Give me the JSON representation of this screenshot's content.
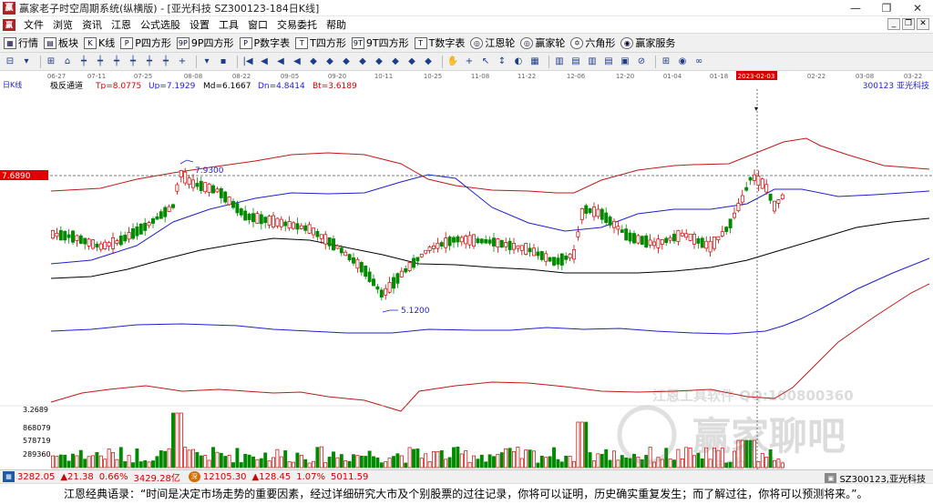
{
  "window": {
    "title": "赢家老子时空周期系统(纵横版) - [亚光科技  SZ300123-184日K线]",
    "controls": [
      "—",
      "❐",
      "✕"
    ]
  },
  "menu": {
    "items": [
      "文件",
      "浏览",
      "资讯",
      "江恩",
      "公式选股",
      "设置",
      "工具",
      "窗口",
      "交易委托",
      "帮助"
    ],
    "mdi": [
      "_",
      "❐",
      "✕"
    ]
  },
  "toolbar1": {
    "items": [
      {
        "icon": "grid-icon",
        "glyph": "▦",
        "label": "行情"
      },
      {
        "icon": "blocks-icon",
        "glyph": "▤",
        "label": "板块"
      },
      {
        "icon": "kline-icon",
        "glyph": "K",
        "label": "K线"
      },
      {
        "icon": "p-square-icon",
        "glyph": "P",
        "label": "P四方形"
      },
      {
        "icon": "9p-square-icon",
        "glyph": "9P",
        "label": "9P四方形"
      },
      {
        "icon": "p-table-icon",
        "glyph": "P",
        "label": "P数字表"
      },
      {
        "icon": "t-square-icon",
        "glyph": "T",
        "label": "T四方形"
      },
      {
        "icon": "9t-square-icon",
        "glyph": "9T",
        "label": "9T四方形"
      },
      {
        "icon": "t-table-icon",
        "glyph": "T",
        "label": "T数字表"
      },
      {
        "icon": "gann-wheel-icon",
        "glyph": "◎",
        "label": "江恩轮"
      },
      {
        "icon": "winner-wheel-icon",
        "glyph": "◎",
        "label": "赢家轮"
      },
      {
        "icon": "hexagon-icon",
        "glyph": "✡",
        "label": "六角形"
      },
      {
        "icon": "winner-service-icon",
        "glyph": "◉",
        "label": "赢家服务"
      }
    ]
  },
  "toolbar2": {
    "buttons": [
      "⊟",
      "▾",
      "⊞",
      "⌂",
      "┿",
      "┿",
      "┿",
      "┿",
      "┿",
      "┿",
      "+",
      "▾",
      "▪",
      "|◀",
      "◀",
      "◀",
      "◀",
      "◆",
      "◆",
      "◆",
      "◆",
      "◆",
      "◆",
      "◆",
      "◆",
      "✋",
      "+",
      "↖",
      "↕",
      "◐",
      "▦",
      "▥",
      "▤",
      "▥",
      "▤",
      "▣",
      "⊘",
      "⊞",
      "◉",
      "∞"
    ]
  },
  "chart": {
    "period": "日K线",
    "indicator_name": "极反通道",
    "params": [
      {
        "label": "Tp=8.0775",
        "color": "#d40000"
      },
      {
        "label": "Up=7.1929",
        "color": "#1f1fd0"
      },
      {
        "label": "Md=6.1667",
        "color": "#000000"
      },
      {
        "label": "Dn=4.8414",
        "color": "#1f1fd0"
      },
      {
        "label": "Bt=3.6189",
        "color": "#d40000"
      }
    ],
    "stock_label": "300123 亚光科技",
    "dates": [
      "06-27",
      "07-11",
      "07-25",
      "08-08",
      "08-22",
      "09-05",
      "09-20",
      "10-11",
      "10-25",
      "11-08",
      "11-22",
      "12-06",
      "12-20",
      "01-04",
      "01-18",
      "2023-02-03",
      "02-22",
      "03-08",
      "03-22"
    ],
    "cursor_date": "2023-02-03",
    "price_marker": "7.6890",
    "high_label": "7.9300",
    "low_label": "5.1200",
    "volume_ticks": [
      "3.2689",
      "868079",
      "578719",
      "289360"
    ]
  },
  "colors": {
    "up": "#d40000",
    "down": "#008a00",
    "upper_band": "#c01818",
    "channel": "#1f1fd0",
    "middle": "#000000"
  },
  "status": {
    "sh_value": "3282.05",
    "sh_change": "▲21.38",
    "sh_pct": "0.66%",
    "sh_amount": "3429.28亿",
    "sz_value": "12105.30",
    "sz_change": "▲128.45",
    "sz_pct": "1.07%",
    "sz_amount": "5011.59",
    "stock": "SZ300123,亚光科技"
  },
  "quote": {
    "text": "江恩经典语录：“时间是决定市场走势的重要因素，经过详细研究大市及个别股票的过往记录，你将可以证明，历史确实重复发生；而了解过往，你将可以预测将来。”。"
  },
  "watermark": {
    "line1": "江恩工具软件 QQ:100800360",
    "line2": "赢家聊吧",
    "line3": "liaoba.vip"
  }
}
